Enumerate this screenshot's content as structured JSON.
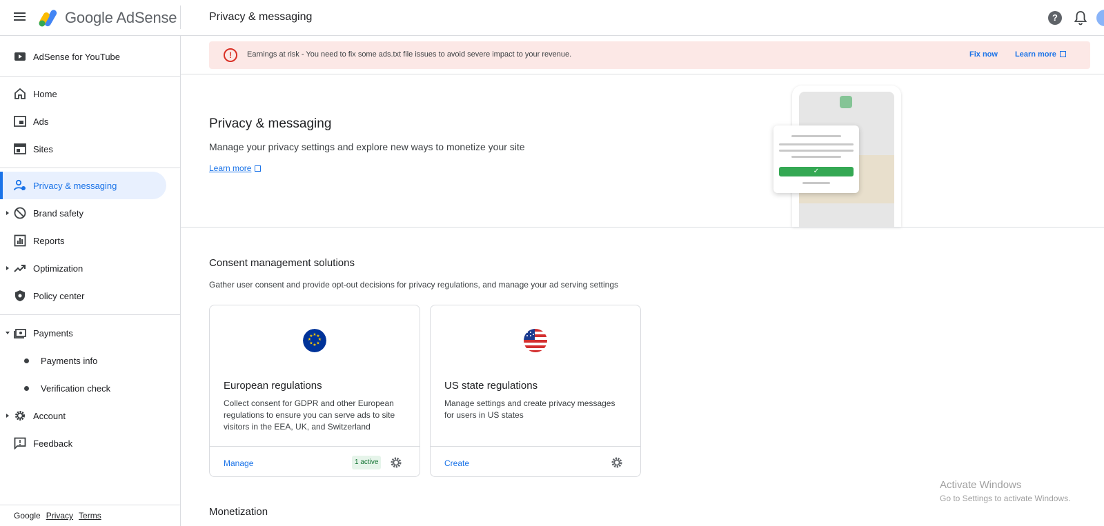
{
  "header": {
    "product_name": "Google AdSense",
    "page_title": "Privacy & messaging"
  },
  "sidebar": {
    "youtube_item": "AdSense for YouTube",
    "items": [
      {
        "label": "Home",
        "icon": "home-icon"
      },
      {
        "label": "Ads",
        "icon": "ads-icon"
      },
      {
        "label": "Sites",
        "icon": "sites-icon"
      },
      {
        "label": "Privacy & messaging",
        "icon": "privacy-icon",
        "active": true
      },
      {
        "label": "Brand safety",
        "icon": "block-icon"
      },
      {
        "label": "Reports",
        "icon": "reports-icon"
      },
      {
        "label": "Optimization",
        "icon": "trending-icon"
      },
      {
        "label": "Policy center",
        "icon": "shield-icon"
      },
      {
        "label": "Payments",
        "icon": "payments-icon"
      },
      {
        "label": "Payments info",
        "icon": "bullet"
      },
      {
        "label": "Verification check",
        "icon": "bullet"
      },
      {
        "label": "Account",
        "icon": "gear-icon"
      },
      {
        "label": "Feedback",
        "icon": "feedback-icon"
      }
    ],
    "footer": {
      "google": "Google",
      "privacy": "Privacy",
      "terms": "Terms"
    }
  },
  "alert": {
    "message": "Earnings at risk - You need to fix some ads.txt file issues to avoid severe impact to your revenue.",
    "fix_label": "Fix now",
    "learn_label": "Learn more"
  },
  "hero": {
    "title": "Privacy & messaging",
    "subtitle": "Manage your privacy settings and explore new ways to monetize your site",
    "learn_more": "Learn more"
  },
  "consent": {
    "title": "Consent management solutions",
    "subtitle": "Gather user consent and provide opt-out decisions for privacy regulations, and manage your ad serving settings",
    "cards": [
      {
        "title": "European regulations",
        "description": "Collect consent for GDPR and other European regulations to ensure you can serve ads to site visitors in the EEA, UK, and Switzerland",
        "action": "Manage",
        "badge": "1 active"
      },
      {
        "title": "US state regulations",
        "description": "Manage settings and create privacy messages for users in US states",
        "action": "Create"
      }
    ]
  },
  "monetization": {
    "title": "Monetization"
  },
  "watermark": {
    "line1": "Activate Windows",
    "line2": "Go to Settings to activate Windows."
  },
  "colors": {
    "accent": "#1a73e8",
    "alert_bg": "#fce8e6",
    "error": "#d93025",
    "active_bg": "#e8f0fe",
    "badge_bg": "#e6f4ea"
  }
}
